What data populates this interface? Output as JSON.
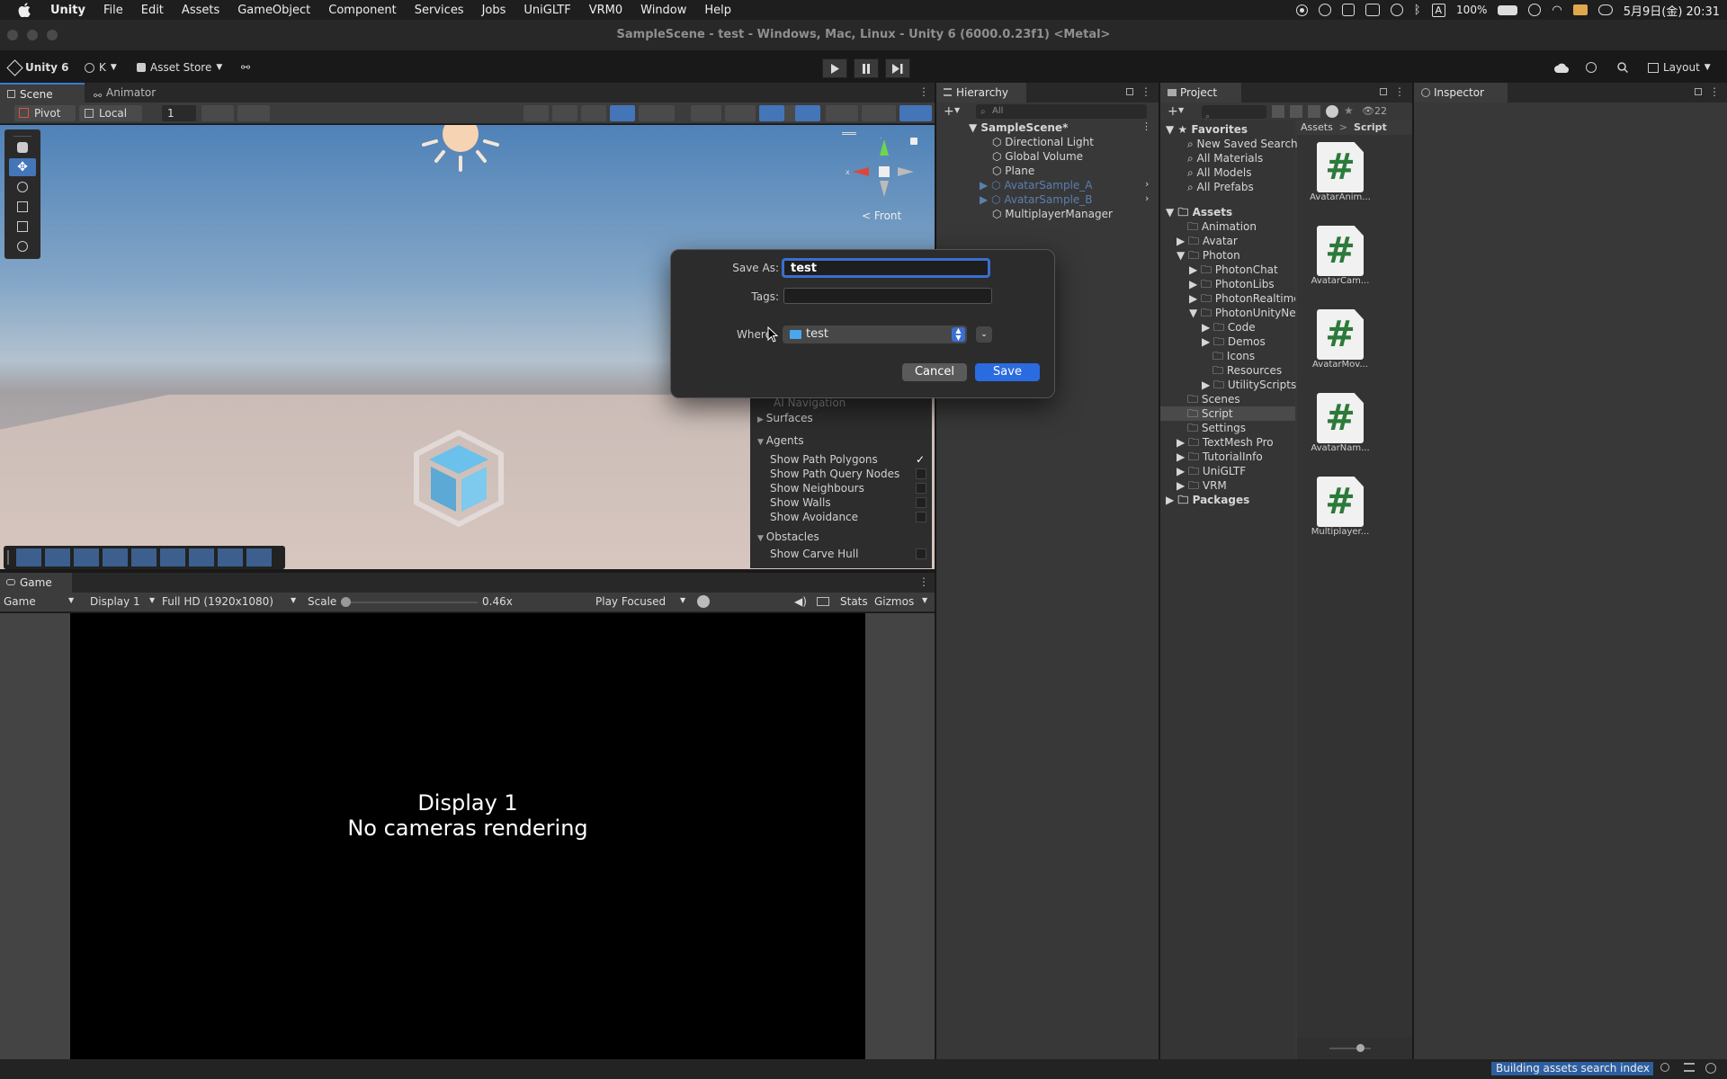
{
  "menubar": {
    "app": "Unity",
    "items": [
      "File",
      "Edit",
      "Assets",
      "GameObject",
      "Component",
      "Services",
      "Jobs",
      "UniGLTF",
      "VRM0",
      "Window",
      "Help"
    ],
    "input_mode": "A",
    "battery": "100%",
    "clock": "5月9日(金) 20:31"
  },
  "window": {
    "title": "SampleScene - test - Windows, Mac, Linux - Unity 6 (6000.0.23f1) <Metal>"
  },
  "toolbar": {
    "unity_label": "Unity 6",
    "account": "K",
    "asset_store": "Asset Store",
    "layout": "Layout"
  },
  "scene": {
    "tabs": [
      "Scene",
      "Animator"
    ],
    "pivot": "Pivot",
    "local": "Local",
    "grid_value": "1",
    "gizmo_label": "< Front"
  },
  "ai_nav": {
    "title": "AI Navigation",
    "surfaces": "Surfaces",
    "agents": "Agents",
    "agent_items": [
      "Show Path Polygons",
      "Show Path Query Nodes",
      "Show Neighbours",
      "Show Walls",
      "Show Avoidance"
    ],
    "agent_checked": [
      true,
      false,
      false,
      false,
      false
    ],
    "obstacles": "Obstacles",
    "obstacle_items": [
      "Show Carve Hull"
    ]
  },
  "game": {
    "tab": "Game",
    "view_select": "Game",
    "display": "Display 1",
    "resolution": "Full HD (1920x1080)",
    "scale_label": "Scale",
    "scale_value": "0.46x",
    "play_mode": "Play Focused",
    "stats": "Stats",
    "gizmos": "Gizmos",
    "message_line1": "Display 1",
    "message_line2": "No cameras rendering"
  },
  "hierarchy": {
    "tab": "Hierarchy",
    "search_placeholder": "All",
    "scene": "SampleScene*",
    "items": [
      "Directional Light",
      "Global Volume",
      "Plane",
      "AvatarSample_A",
      "AvatarSample_B",
      "MultiplayerManager"
    ]
  },
  "project": {
    "tab": "Project",
    "favorites": "Favorites",
    "fav_items": [
      "New Saved Search",
      "All Materials",
      "All Models",
      "All Prefabs"
    ],
    "assets": "Assets",
    "folders": [
      "Animation",
      "Avatar",
      "Photon",
      "PhotonChat",
      "PhotonLibs",
      "PhotonRealtime",
      "PhotonUnityNetworking",
      "Code",
      "Demos",
      "Icons",
      "Resources",
      "UtilityScripts",
      "Scenes",
      "Script",
      "Settings",
      "TextMesh Pro",
      "TutorialInfo",
      "UniGLTF",
      "VRM"
    ],
    "packages": "Packages",
    "breadcrumb": [
      "Assets",
      "Script"
    ],
    "count": "22",
    "files": [
      "AvatarAnim...",
      "AvatarCam...",
      "AvatarMov...",
      "AvatarNam...",
      "Multiplayer..."
    ]
  },
  "inspector": {
    "tab": "Inspector"
  },
  "dialog": {
    "save_as_label": "Save As:",
    "save_as_value": "test",
    "tags_label": "Tags:",
    "where_label": "Where:",
    "where_value": "test",
    "cancel": "Cancel",
    "save": "Save"
  },
  "status": {
    "building": "Building assets search index"
  }
}
